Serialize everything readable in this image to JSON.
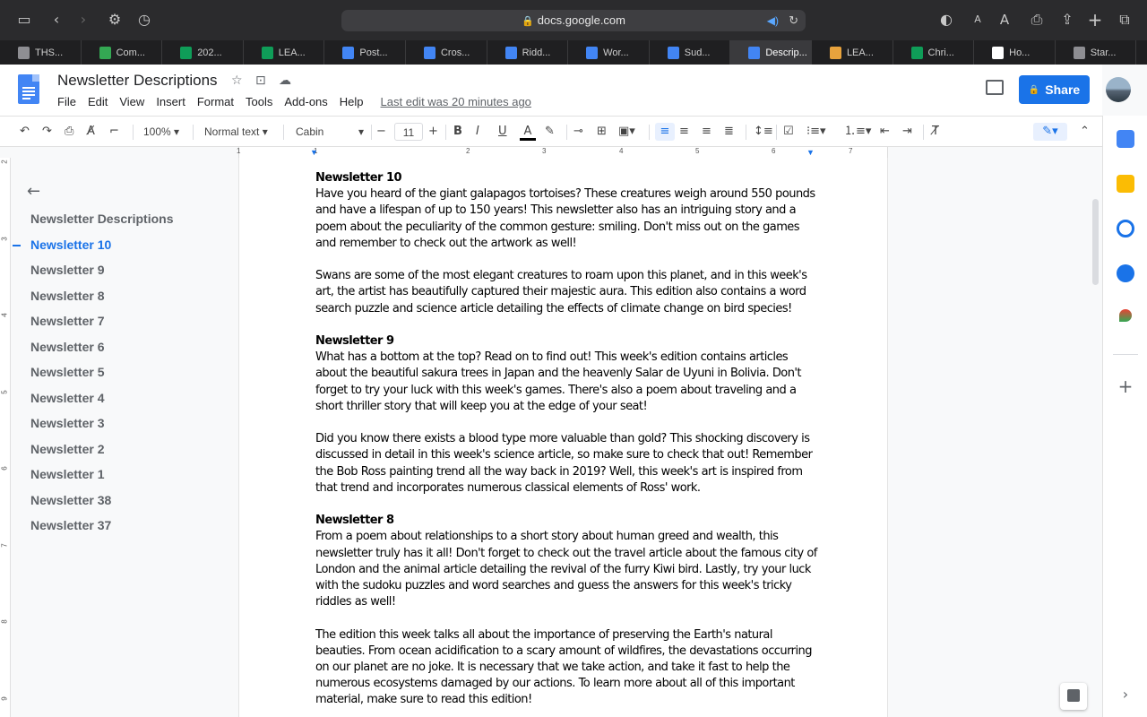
{
  "browser": {
    "url": "docs.google.com",
    "tabs": [
      {
        "label": "THS...",
        "color": "#8e8e93"
      },
      {
        "label": "Com...",
        "color": "#34a853"
      },
      {
        "label": "202...",
        "color": "#0f9d58"
      },
      {
        "label": "LEA...",
        "color": "#0f9d58"
      },
      {
        "label": "Post...",
        "color": "#4285f4"
      },
      {
        "label": "Cros...",
        "color": "#4285f4"
      },
      {
        "label": "Ridd...",
        "color": "#4285f4"
      },
      {
        "label": "Wor...",
        "color": "#4285f4"
      },
      {
        "label": "Sud...",
        "color": "#4285f4"
      },
      {
        "label": "Descrip...",
        "color": "#4285f4"
      },
      {
        "label": "LEA...",
        "color": "#e8a33d"
      },
      {
        "label": "Chri...",
        "color": "#0f9d58"
      },
      {
        "label": "Ho...",
        "color": "#ffffff"
      },
      {
        "label": "Star...",
        "color": "#8e8e93"
      }
    ]
  },
  "doc": {
    "title": "Newsletter Descriptions",
    "menu": [
      "File",
      "Edit",
      "View",
      "Insert",
      "Format",
      "Tools",
      "Add-ons",
      "Help"
    ],
    "last_edit": "Last edit was 20 minutes ago",
    "share_label": "Share"
  },
  "toolbar": {
    "zoom": "100%",
    "style": "Normal text",
    "font": "Cabin",
    "font_size": "11"
  },
  "outline": {
    "items": [
      "Newsletter Descriptions",
      "Newsletter 10",
      "Newsletter 9",
      "Newsletter 8",
      "Newsletter 7",
      "Newsletter 6",
      "Newsletter 5",
      "Newsletter 4",
      "Newsletter 3",
      "Newsletter 2",
      "Newsletter 1",
      "Newsletter 38",
      "Newsletter 37"
    ],
    "selected_index": 1
  },
  "content": {
    "n10_heading": "Newsletter 10",
    "n10_p1": "Have you heard of the giant galapagos tortoises? These creatures weigh around 550 pounds and have a lifespan of up to 150 years! This newsletter also has an intriguing story and a poem about the peculiarity of the common gesture: smiling. Don't miss out on the games and remember to check out the artwork as well!",
    "n10_p2": "Swans are some of the most elegant creatures to roam upon this planet, and in this week's art, the artist has beautifully captured their majestic aura. This edition also contains a word search puzzle and science article detailing the effects of climate change on bird species!",
    "n9_heading": "Newsletter 9",
    "n9_p1": "What has a bottom at the top? Read on to find out! This week's edition contains articles about the beautiful sakura trees in Japan and the heavenly Salar de Uyuni in Bolivia. Don't forget to try your luck with this week's games. There's also a poem about traveling and a short thriller story that will keep you at the edge of your seat!",
    "n9_p2": "Did you know there exists a blood type more valuable than gold? This shocking discovery is discussed in detail in this week's science article, so make sure to check that out! Remember the Bob Ross painting trend all the way back in 2019? Well, this week's art is inspired from that trend and incorporates numerous classical elements of Ross' work.",
    "n8_heading": "Newsletter 8",
    "n8_p1": "From a poem about relationships to a short story about human greed and wealth, this newsletter truly has it all! Don't forget to check out the travel article about the famous city of London and the animal article detailing the revival of the furry Kiwi bird. Lastly, try your luck with the sudoku puzzles and word searches and guess the answers for this week's tricky riddles as well!",
    "n8_p2": "The edition this week talks all about the importance of preserving the Earth's natural beauties. From ocean acidification to a scary amount of wildfires, the devastations occurring on our planet are no joke. It is necessary that we take action, and take it fast to help the numerous ecosystems damaged by our actions. To learn more about all of this important material, make sure to read this edition!"
  },
  "ruler": [
    "1",
    "1",
    "2",
    "3",
    "4",
    "5",
    "6",
    "7"
  ],
  "vruler": [
    "2",
    "3",
    "4",
    "5",
    "6",
    "7",
    "8",
    "9"
  ]
}
